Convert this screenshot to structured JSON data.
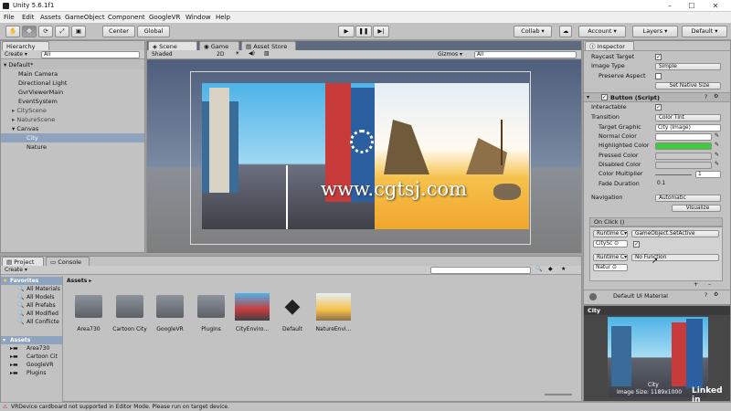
{
  "window": {
    "title": "Unity 5.6.1f1",
    "controls": [
      "–",
      "☐",
      "✕"
    ]
  },
  "menu": [
    "File",
    "Edit",
    "Assets",
    "GameObject",
    "Component",
    "GoogleVR",
    "Window",
    "Help"
  ],
  "toolbar": {
    "center": "Center",
    "global": "Global",
    "collab": "Collab ▾",
    "account": "Account ▾",
    "layers": "Layers ▾",
    "layout": "Default ▾"
  },
  "hierarchy": {
    "tab": "Hierarchy",
    "create": "Create ▾",
    "search": "All",
    "scene": "Default*",
    "items": [
      "Main Camera",
      "Directional Light",
      "GvrViewerMain",
      "EventSystem",
      "CityScene",
      "NatureScene",
      "Canvas",
      "City",
      "Nature"
    ]
  },
  "scene": {
    "tabs": [
      "Scene",
      "Game",
      "Asset Store"
    ],
    "shaded": "Shaded",
    "mode2d": "2D",
    "gizmos": "Gizmos ▾",
    "search": "All"
  },
  "watermark": "www.cgtsj.com",
  "project": {
    "tabs": [
      "Project",
      "Console"
    ],
    "create": "Create ▾",
    "favorites": "Favorites",
    "fav_items": [
      "All Materials",
      "All Models",
      "All Prefabs",
      "All Modified",
      "All Conflicte"
    ],
    "assets_root": "Assets",
    "asset_tree": [
      "Area730",
      "Cartoon Cit",
      "GoogleVR",
      "Plugins"
    ],
    "breadcrumb": "Assets ▸",
    "assets": [
      "Area730",
      "Cartoon City",
      "GoogleVR",
      "Plugins",
      "CityEnviro...",
      "Default",
      "NatureEnvi..."
    ]
  },
  "inspector": {
    "tab": "Inspector",
    "raycast": "Raycast Target",
    "image_type": "Image Type",
    "image_type_val": "Simple",
    "preserve": "Preserve Aspect",
    "set_native": "Set Native Size",
    "button_header": "Button (Script)",
    "interactable": "Interactable",
    "transition": "Transition",
    "transition_val": "Color Tint",
    "target_graphic": "Target Graphic",
    "target_graphic_val": "City (Image)",
    "normal": "Normal Color",
    "highlighted": "Highlighted Color",
    "pressed": "Pressed Color",
    "disabled": "Disabled Color",
    "multiplier": "Color Multiplier",
    "multiplier_val": "1",
    "fade": "Fade Duration",
    "fade_val": "0.1",
    "navigation": "Navigation",
    "navigation_val": "Automatic",
    "visualize": "Visualize",
    "onclick": "On Click ()",
    "runtime1": "Runtime C▾",
    "func1": "GameObject.SetActive",
    "obj1": "CitySc ⊙",
    "runtime2": "Runtime C▾",
    "func2": "No Function",
    "obj2": "Natur ⊙",
    "plus": "+",
    "minus": "–",
    "material": "Default UI Material",
    "colors": {
      "normal": "#ffffff",
      "highlighted": "#3ccc3c",
      "pressed": "#c8c8c8",
      "disabled": "#c8c8c8"
    }
  },
  "preview": {
    "label": "City",
    "caption": "City",
    "size": "Image Size: 1189x1000"
  },
  "status": "VRDevice cardboard not supported in Editor Mode.  Please run on target device.",
  "linkedin": "Linked in"
}
